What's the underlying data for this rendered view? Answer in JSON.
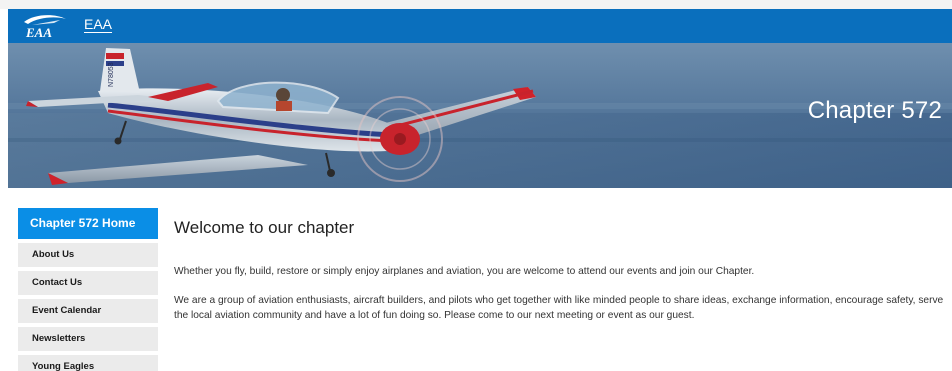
{
  "header": {
    "brand_link": "EAA",
    "logo_text": "EAA"
  },
  "hero": {
    "title": "Chapter 572",
    "tail_code": "N78053"
  },
  "sidebar": {
    "home_label": "Chapter 572 Home",
    "items": [
      {
        "label": "About Us"
      },
      {
        "label": "Contact Us"
      },
      {
        "label": "Event Calendar"
      },
      {
        "label": "Newsletters"
      },
      {
        "label": "Young Eagles"
      }
    ]
  },
  "main": {
    "heading": "Welcome to our chapter",
    "paragraphs": [
      "Whether you fly, build, restore or simply enjoy airplanes and aviation, you are welcome to attend our events and join our Chapter.",
      "We are a group of aviation enthusiasts, aircraft builders, and pilots who get together with like minded people to share ideas, exchange information, encourage safety, serve the local aviation community and have a lot of fun doing so. Please come to our next meeting or event as our guest."
    ]
  },
  "colors": {
    "header_blue": "#0a6fbd",
    "sidebar_active": "#0a8ee6",
    "sidebar_item_bg": "#ebebeb"
  }
}
